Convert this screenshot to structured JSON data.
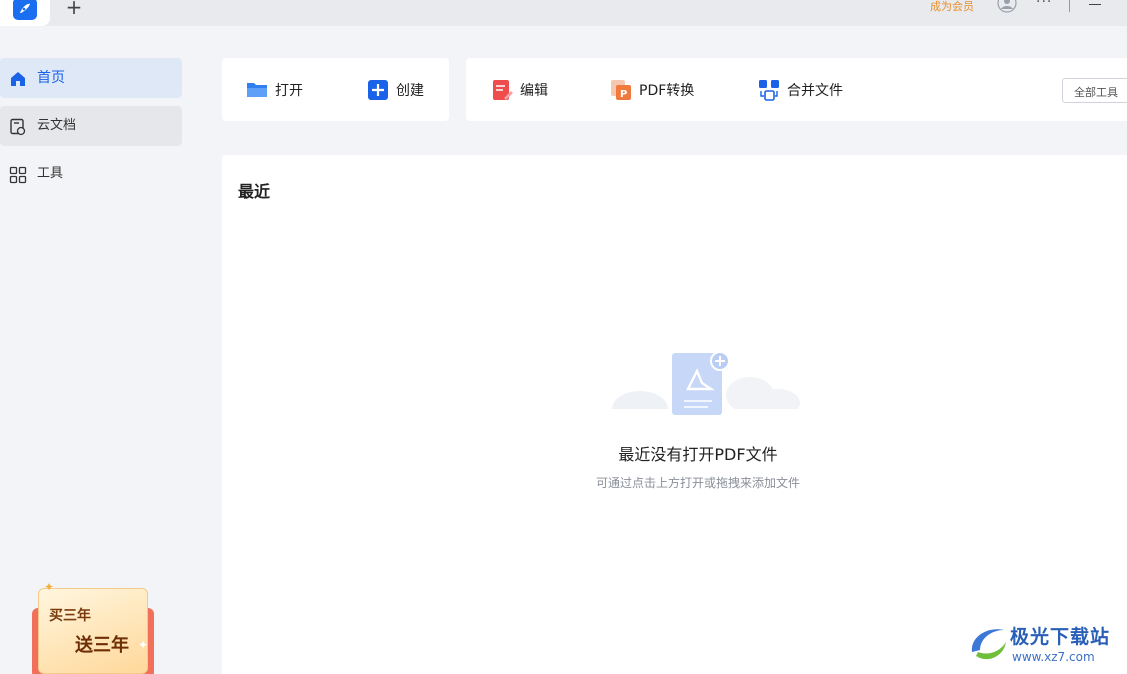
{
  "colors": {
    "accent": "#1a62e8",
    "vip": "#e8902a",
    "edit_icon": "#ef4d4d",
    "convert_icon": "#f07a3c"
  },
  "titlebar": {
    "new_tab": "+",
    "vip_label": "成为会员",
    "more": "···",
    "icons": [
      "app-logo-icon",
      "avatar-icon",
      "more-icon",
      "minimize-icon"
    ]
  },
  "sidebar": {
    "items": [
      {
        "label": "首页",
        "icon": "home-icon",
        "active": true
      },
      {
        "label": "云文档",
        "icon": "cloud-doc-icon",
        "active": false
      },
      {
        "label": "工具",
        "icon": "grid-icon",
        "active": false
      }
    ],
    "promo": {
      "line1": "买三年",
      "line2": "送三年"
    }
  },
  "toolbar": {
    "quick": [
      {
        "label": "打开",
        "icon": "folder-icon"
      },
      {
        "label": "创建",
        "icon": "plus-square-icon"
      }
    ],
    "tools": [
      {
        "label": "编辑",
        "icon": "edit-doc-icon"
      },
      {
        "label": "PDF转换",
        "icon": "pdf-convert-icon"
      },
      {
        "label": "合并文件",
        "icon": "merge-icon"
      }
    ],
    "all_tools": "全部工具"
  },
  "recent": {
    "title": "最近",
    "empty_title": "最近没有打开PDF文件",
    "empty_subtitle": "可通过点击上方打开或拖拽来添加文件"
  },
  "watermark": {
    "title": "极光下载站",
    "url": "www.xz7.com"
  }
}
